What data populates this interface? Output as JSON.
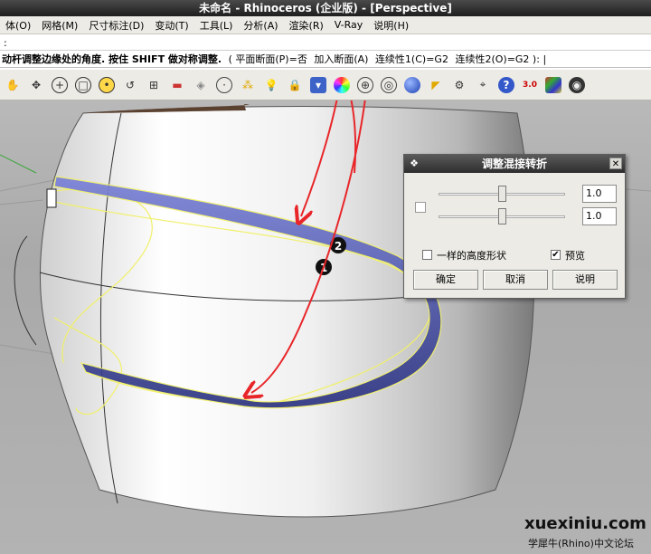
{
  "window": {
    "title": "未命名 - Rhinoceros (企业版) - [Perspective]"
  },
  "menu": [
    "体(O)",
    "网格(M)",
    "尺寸标注(D)",
    "变动(T)",
    "工具(L)",
    "分析(A)",
    "渲染(R)",
    "V-Ray",
    "说明(H)"
  ],
  "command": {
    "history": ":",
    "prompt": "动杆调整边缘处的角度. 按住 SHIFT 做对称调整.",
    "option1": "( 平面断面(P)=否",
    "option2": "加入断面(A)",
    "option3": "连续性1(C)=G2",
    "option4": "连续性2(O)=G2 ):"
  },
  "toolbar": {
    "icons": [
      "pan-hand-icon",
      "rotate-view-icon",
      "zoom-window-icon",
      "zoom-extents-icon",
      "zoom-selected-icon",
      "undo-view-icon",
      "four-viewports-icon",
      "car-icon",
      "grid-snap-icon",
      "circle-icon",
      "points-icon",
      "light-bulb-icon",
      "lock-icon",
      "shield-icon",
      "color-wheel-icon",
      "globe-icon",
      "sphere-wire-icon",
      "blue-sphere-icon",
      "spotlight-icon",
      "gear-icon",
      "analyze-icon",
      "help-icon",
      "render-icon",
      "materials-icon",
      "camera-icon"
    ]
  },
  "dialog": {
    "title": "调整混接转折",
    "value1": "1.0",
    "value2": "1.0",
    "same_height_label": "一样的高度形状",
    "same_height_checked": false,
    "preview_label": "预览",
    "preview_checked": true,
    "ok_label": "确定",
    "cancel_label": "取消",
    "help_label": "说明"
  },
  "viewport": {
    "marker1": "1",
    "marker2": "2"
  },
  "watermark": {
    "site": "xuexiniu.com",
    "subtitle": "学犀牛(Rhino)中文论坛"
  },
  "colors": {
    "annotation": "#e8262a",
    "surface_edge": "#f1f06a",
    "blend_surface": "#4a4fa8"
  }
}
